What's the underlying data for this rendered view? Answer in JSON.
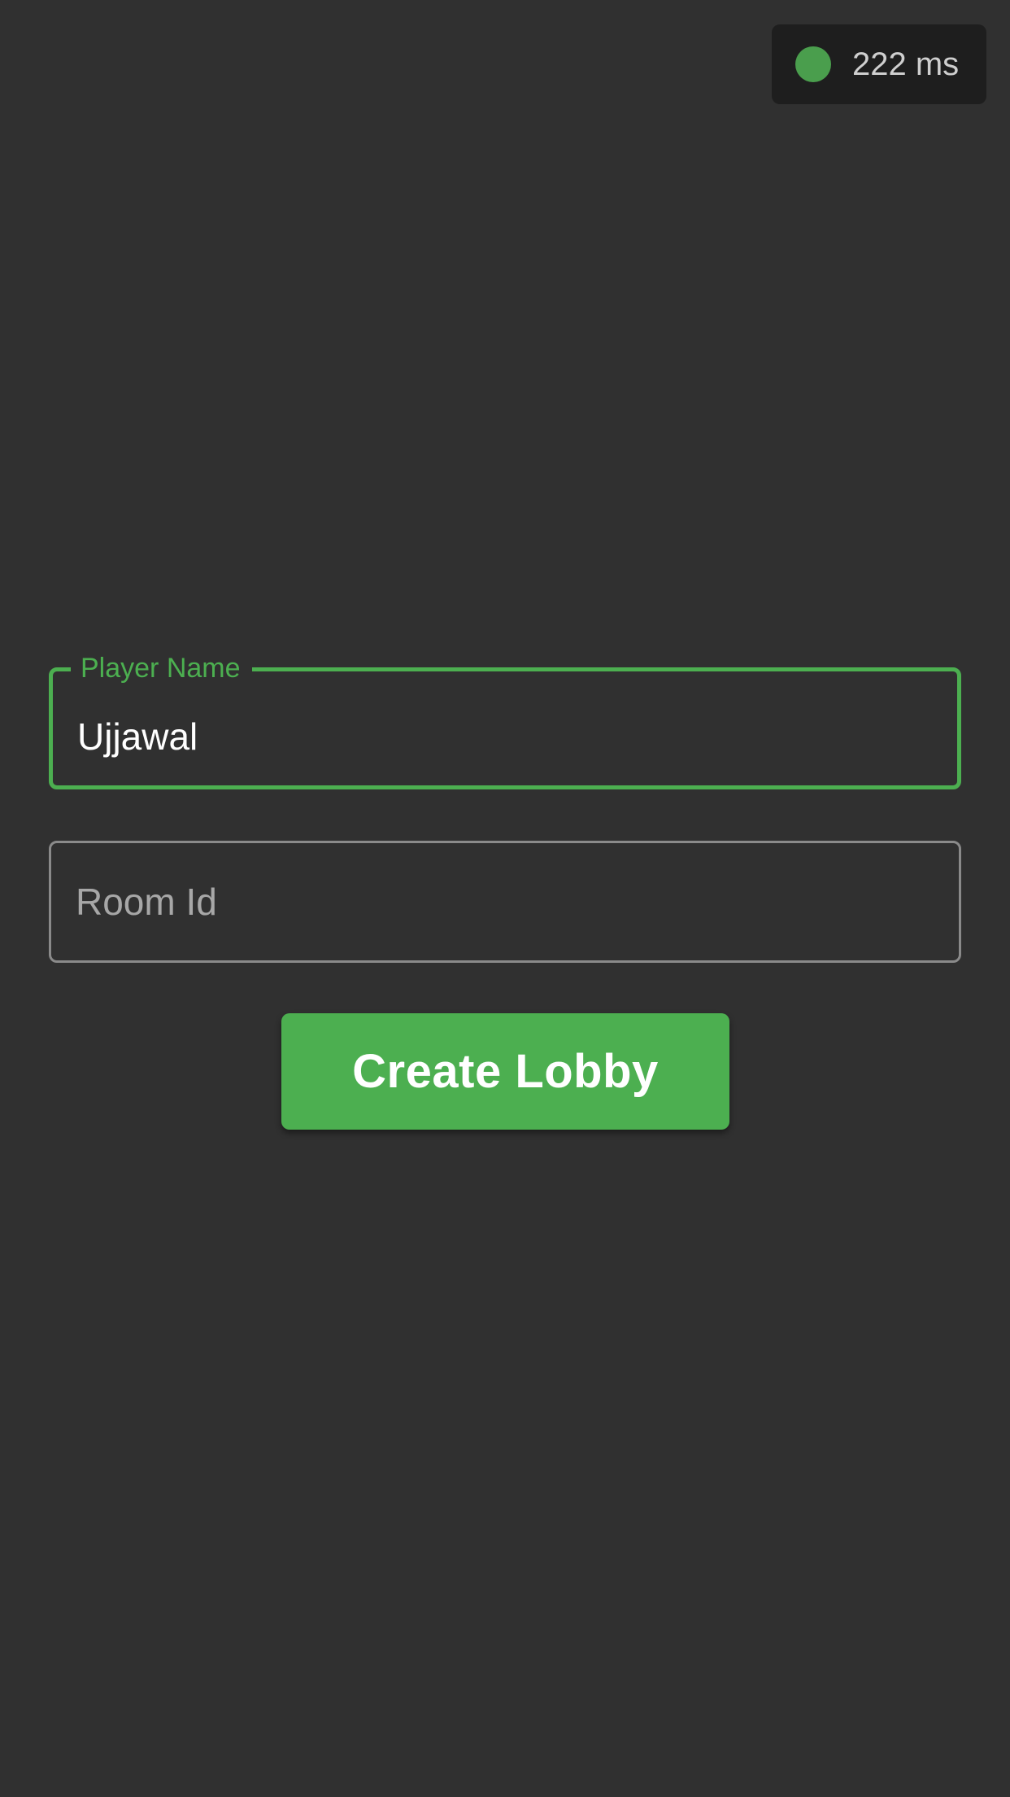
{
  "theme": {
    "background": "#303030",
    "accent": "#4caf50",
    "ping_dot_color": "#4a9e4d"
  },
  "status": {
    "ping_icon": "status-dot-icon",
    "ping_text": "222 ms"
  },
  "form": {
    "player_name": {
      "label": "Player Name",
      "value": "Ujjawal"
    },
    "room_id": {
      "placeholder": "Room Id",
      "value": ""
    },
    "create_label": "Create Lobby"
  }
}
